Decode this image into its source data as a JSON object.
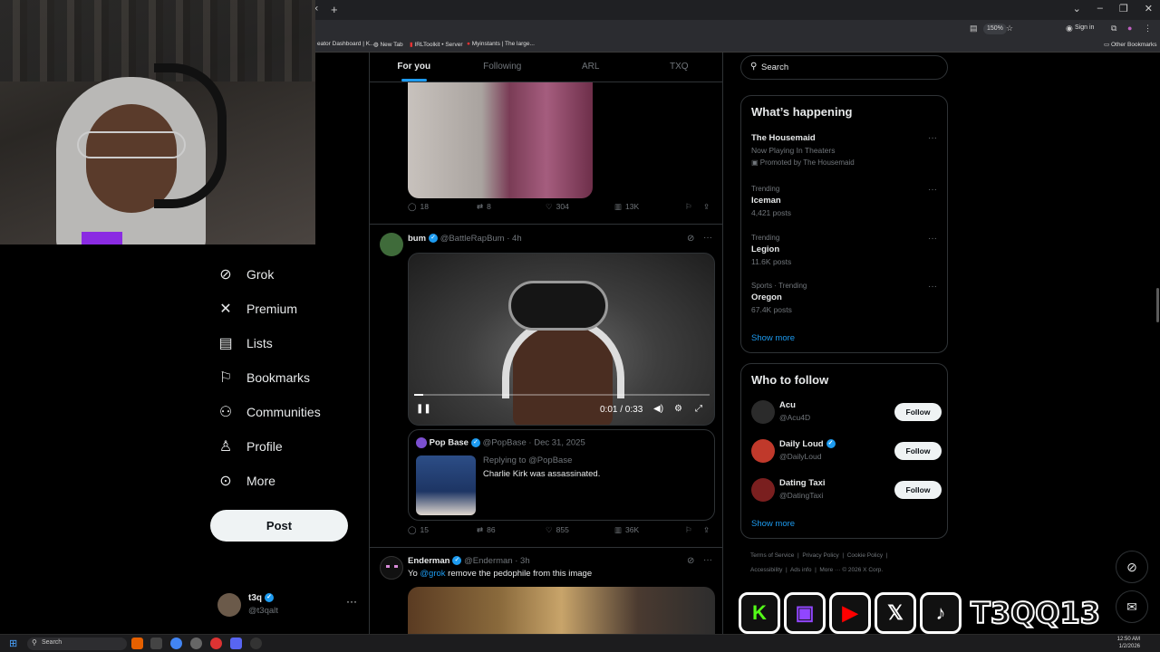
{
  "browser": {
    "tab_close": "×",
    "tab_new": "+",
    "zoom": "150%",
    "sign_in": "Sign in",
    "bookmarks": [
      "eator Dashboard | K...",
      "New Tab",
      "IRLToolkit • Server",
      "Myinstants | The large...",
      "Other Bookmarks"
    ]
  },
  "nav": {
    "items": [
      {
        "label": "Grok",
        "icon": "grok-icon"
      },
      {
        "label": "Premium",
        "icon": "x-logo-icon"
      },
      {
        "label": "Lists",
        "icon": "lists-icon"
      },
      {
        "label": "Bookmarks",
        "icon": "bookmark-icon"
      },
      {
        "label": "Communities",
        "icon": "communities-icon"
      },
      {
        "label": "Profile",
        "icon": "profile-icon"
      },
      {
        "label": "More",
        "icon": "more-circle-icon"
      }
    ],
    "post_label": "Post",
    "account": {
      "name": "t3q",
      "handle": "@t3qalt",
      "more": "···"
    }
  },
  "timeline": {
    "tabs": [
      {
        "label": "For you",
        "active": true
      },
      {
        "label": "Following",
        "active": false
      },
      {
        "label": "ARL",
        "active": false
      },
      {
        "label": "TXQ",
        "active": false
      }
    ],
    "tweet1": {
      "replies": "18",
      "retweets": "8",
      "likes": "304",
      "views": "13K"
    },
    "tweet2": {
      "name": "bum",
      "handle": "@BattleRapBum",
      "time": "· 4h",
      "video_time": "0:01 / 0:33",
      "video_progress": 0.03,
      "quote": {
        "name": "Pop Base",
        "handle": "@PopBase",
        "date": "· Dec 31, 2025",
        "replying": "Replying to @PopBase",
        "text": "Charlie Kirk was assassinated."
      },
      "replies": "15",
      "retweets": "86",
      "likes": "855",
      "views": "36K"
    },
    "tweet3": {
      "name": "Enderman",
      "handle": "@Enderman",
      "time": "· 3h",
      "text_before": "Yo ",
      "mention": "@grok",
      "text_after": " remove the pedophile from this image"
    }
  },
  "sidebar": {
    "search_placeholder": "Search",
    "happening": {
      "title": "What’s happening",
      "trends": [
        {
          "context": "",
          "name": "The Housemaid",
          "sub": "Now Playing In Theaters",
          "promo": "Promoted by The Housemaid"
        },
        {
          "context": "Trending",
          "name": "Iceman",
          "sub": "4,421 posts"
        },
        {
          "context": "Trending",
          "name": "Legion",
          "sub": "11.6K posts"
        },
        {
          "context": "Sports · Trending",
          "name": "Oregon",
          "sub": "67.4K posts"
        }
      ],
      "show_more": "Show more"
    },
    "who_to_follow": {
      "title": "Who to follow",
      "accounts": [
        {
          "name": "Acu",
          "handle": "@Acu4D",
          "button": "Follow",
          "color": "#2b2b2b"
        },
        {
          "name": "Daily Loud",
          "handle": "@DailyLoud",
          "button": "Follow",
          "color": "#c0392b"
        },
        {
          "name": "Dating Taxi",
          "handle": "@DatingTaxi",
          "button": "Follow",
          "color": "#7a1f1f"
        }
      ],
      "show_more": "Show more"
    },
    "footer": {
      "line1": [
        "Terms of Service",
        "Privacy Policy",
        "Cookie Policy"
      ],
      "line2": [
        "Accessibility",
        "Ads info",
        "More ···",
        "© 2026 X Corp."
      ]
    }
  },
  "overlay": {
    "brand": "T3QQ13",
    "socials": [
      {
        "icon": "kick-icon",
        "glyph": "K",
        "color": "#53fc18"
      },
      {
        "icon": "twitch-icon",
        "glyph": "▣",
        "color": "#9146ff"
      },
      {
        "icon": "youtube-icon",
        "glyph": "▶",
        "color": "#ff0000"
      },
      {
        "icon": "x-icon",
        "glyph": "𝕏",
        "color": "#ffffff"
      },
      {
        "icon": "tiktok-icon",
        "glyph": "♪",
        "color": "#ffffff"
      }
    ]
  },
  "taskbar": {
    "search": "Search",
    "time": "12:50 AM",
    "date": "1/2/2026"
  }
}
